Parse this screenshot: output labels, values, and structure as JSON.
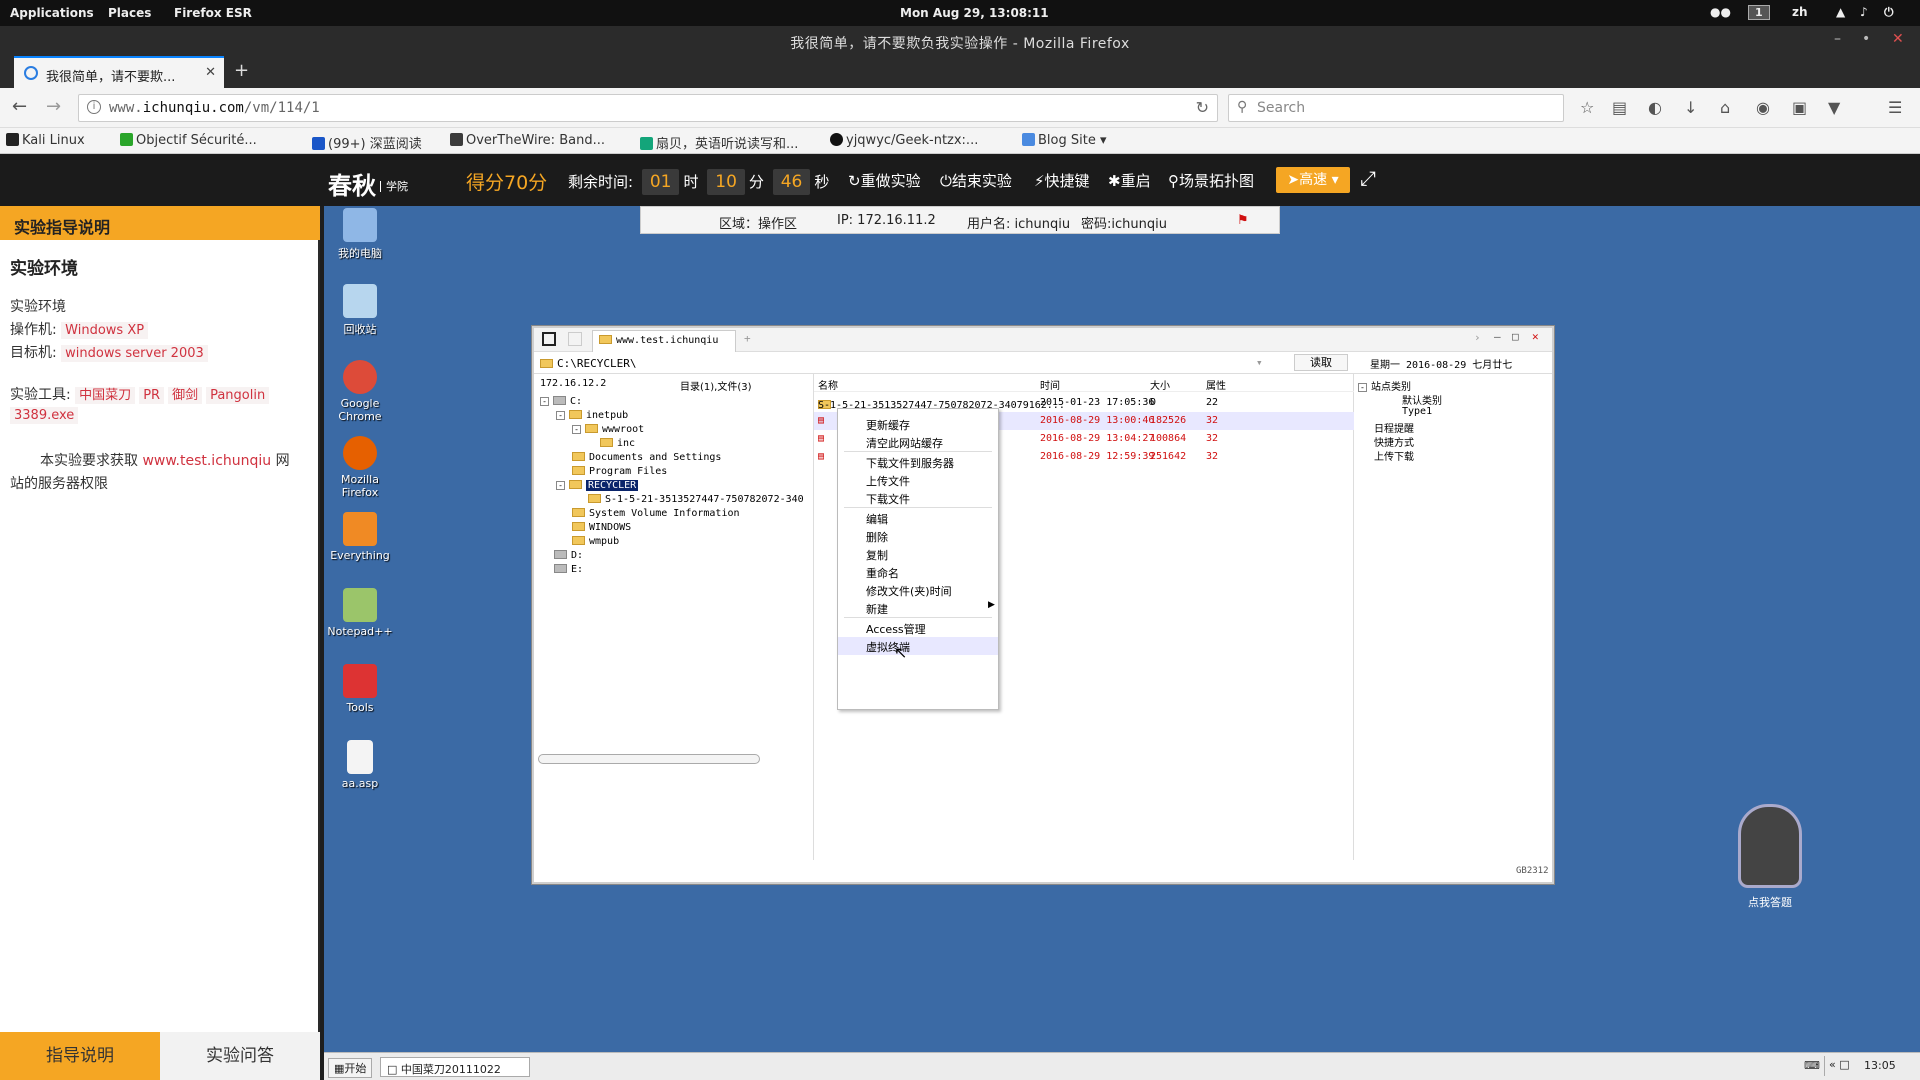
{
  "topbar": {
    "applications": "Applications",
    "places": "Places",
    "app_name": "Firefox ESR",
    "clock": "Mon Aug 29, 13:08:11",
    "workspace": "1",
    "lang": "zh"
  },
  "window": {
    "title": "我很简单，请不要欺负我实验操作 - Mozilla Firefox",
    "tab_label": "我很简单，请不要欺...",
    "url_prefix": "www.",
    "url_domain": "ichunqiu.com",
    "url_path": "/vm/114/1",
    "search_placeholder": "Search"
  },
  "bookmarks": [
    {
      "label": "Kali Linux",
      "color": "#222"
    },
    {
      "label": "Objectif Sécurité...",
      "color": "#2aa52a"
    },
    {
      "label": "(99+) 深蓝阅读",
      "color": "#1a56c8"
    },
    {
      "label": "OverTheWire: Band...",
      "color": "#3b3b3b"
    },
    {
      "label": "扇贝，英语听说读写和...",
      "color": "#13a57a"
    },
    {
      "label": "yjqwyc/Geek-ntzx:...",
      "color": "#111"
    },
    {
      "label": "Blog Site",
      "color": "#4a8ae0"
    }
  ],
  "iq": {
    "logo": "春秋",
    "logo_sub": "学院",
    "score": "得分70分",
    "time_label": "剩余时间:",
    "hours": "01",
    "hours_unit": "时",
    "minutes": "10",
    "minutes_unit": "分",
    "seconds": "46",
    "seconds_unit": "秒",
    "actions": [
      "重做实验",
      "结束实验",
      "快捷键",
      "重启",
      "场景拓扑图"
    ],
    "speed": "高速"
  },
  "guide": {
    "header": "实验指导说明",
    "section_title": "实验环境",
    "env_label": "实验环境",
    "attacker_label": "操作机:",
    "attacker_value": "Windows XP",
    "target_label": "目标机:",
    "target_value": "windows server 2003",
    "tools_label": "实验工具:",
    "tools": [
      "中国菜刀",
      "PR",
      "御剑",
      "Pangolin",
      "3389.exe"
    ],
    "desc_pre": "本实验要求获取",
    "desc_link": "www.test.ichunqiu",
    "desc_post_1": "网",
    "desc_post_2": "站的服务器权限",
    "tab_guide": "指导说明",
    "tab_qa": "实验问答"
  },
  "infobar": {
    "region": "区域：操作区",
    "ip": "IP: 172.16.11.2",
    "user": "用户名: ichunqiu",
    "password": "密码:ichunqiu"
  },
  "desktop_icons": [
    "我的电脑",
    "回收站",
    "Google Chrome",
    "Mozilla Firefox",
    "Everything",
    "Notepad++",
    "Tools",
    "aa.asp"
  ],
  "caidao": {
    "tab": "www.test.ichunqiu",
    "path": "C:\\RECYCLER\\",
    "read_button": "读取",
    "date_header": "星期一 2016-08-29 七月廿七",
    "host": "172.16.12.2",
    "summary": "目录(1),文件(3)",
    "columns": {
      "name": "名称",
      "time": "时间",
      "size": "大小",
      "attr": "属性"
    },
    "tree": [
      "C:",
      "inetpub",
      "wwwroot",
      "inc",
      "Documents and Settings",
      "Program Files",
      "RECYCLER",
      "S-1-5-21-3513527447-750782072-340",
      "System Volume Information",
      "WINDOWS",
      "wmpub",
      "D:",
      "E:"
    ],
    "files": [
      {
        "name": "S-1-5-21-3513527447-750782072-34079162...",
        "time": "2015-01-23 17:05:36",
        "size": "0",
        "attr": "22"
      },
      {
        "name": "",
        "time": "2016-08-29 13:00:46",
        "size": "182526",
        "attr": "32"
      },
      {
        "name": "",
        "time": "2016-08-29 13:04:27",
        "size": "100864",
        "attr": "32"
      },
      {
        "name": "",
        "time": "2016-08-29 12:59:39",
        "size": "251642",
        "attr": "32"
      }
    ],
    "menu": [
      "更新缓存",
      "清空此网站缓存",
      "下载文件到服务器",
      "上传文件",
      "下载文件",
      "编辑",
      "删除",
      "复制",
      "重命名",
      "修改文件(夹)时间",
      "新建",
      "Access管理",
      "虚拟终端"
    ],
    "side": [
      "站点类别",
      "默认类别",
      "Type1",
      "日程提醒",
      "快捷方式",
      "上传下载"
    ],
    "encoding": "GB2312"
  },
  "taskbar": {
    "start": "开始",
    "task": "中国菜刀20111022",
    "time": "13:05"
  },
  "robot_label": "点我答题"
}
